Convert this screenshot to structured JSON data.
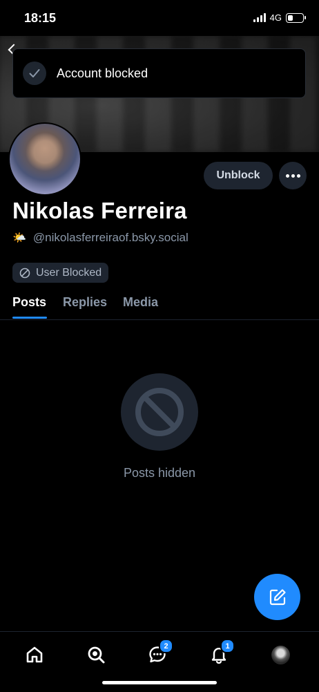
{
  "status_bar": {
    "time": "18:15",
    "network": "4G"
  },
  "toast": {
    "message": "Account blocked"
  },
  "profile": {
    "display_name": "Nikolas Ferreira",
    "handle_emoji": "🌤️",
    "handle": "@nikolasferreiraof.bsky.social",
    "blocked_label": "User Blocked"
  },
  "actions": {
    "unblock_label": "Unblock"
  },
  "tabs": [
    {
      "label": "Posts",
      "active": true
    },
    {
      "label": "Replies",
      "active": false
    },
    {
      "label": "Media",
      "active": false
    }
  ],
  "empty_state": {
    "message": "Posts hidden"
  },
  "bottom_nav": {
    "items": [
      {
        "icon": "home-icon"
      },
      {
        "icon": "search-icon"
      },
      {
        "icon": "chat-icon",
        "badge": "2"
      },
      {
        "icon": "bell-icon",
        "badge": "1"
      },
      {
        "icon": "profile-avatar"
      }
    ]
  },
  "colors": {
    "accent": "#208bfe",
    "surface": "#1e2530",
    "muted_text": "#8b98a9"
  }
}
